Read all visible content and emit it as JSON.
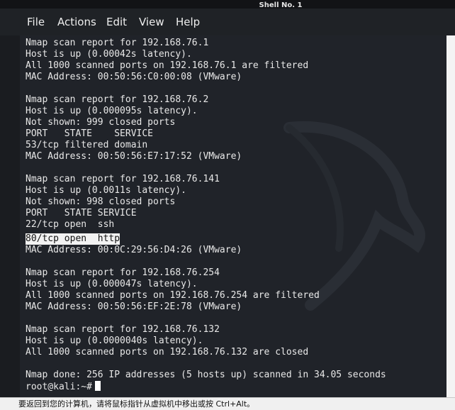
{
  "window": {
    "title": "Shell No. 1"
  },
  "menu": {
    "items": [
      "File",
      "Actions",
      "Edit",
      "View",
      "Help"
    ]
  },
  "terminal": {
    "lines": [
      "Nmap scan report for 192.168.76.1",
      "Host is up (0.00042s latency).",
      "All 1000 scanned ports on 192.168.76.1 are filtered",
      "MAC Address: 00:50:56:C0:00:08 (VMware)",
      "",
      "Nmap scan report for 192.168.76.2",
      "Host is up (0.000095s latency).",
      "Not shown: 999 closed ports",
      "PORT   STATE    SERVICE",
      "53/tcp filtered domain",
      "MAC Address: 00:50:56:E7:17:52 (VMware)",
      "",
      "Nmap scan report for 192.168.76.141",
      "Host is up (0.0011s latency).",
      "Not shown: 998 closed ports",
      "PORT   STATE SERVICE",
      "22/tcp open  ssh",
      "80/tcp open  http",
      "MAC Address: 00:0C:29:56:D4:26 (VMware)",
      "",
      "Nmap scan report for 192.168.76.254",
      "Host is up (0.000047s latency).",
      "All 1000 scanned ports on 192.168.76.254 are filtered",
      "MAC Address: 00:50:56:EF:2E:78 (VMware)",
      "",
      "Nmap scan report for 192.168.76.132",
      "Host is up (0.0000040s latency).",
      "All 1000 scanned ports on 192.168.76.132 are closed",
      "",
      "Nmap done: 256 IP addresses (5 hosts up) scanned in 34.05 seconds",
      "root@kali:~#"
    ],
    "selected_line": "80/tcp open  http"
  },
  "statusbar": {
    "message": "要返回到您的计算机，请将鼠标指针从虚拟机中移出或按 Ctrl+Alt。"
  },
  "colors": {
    "terminal_bg": "#202329",
    "terminal_fg": "#e8e8e8",
    "menubar_bg": "#1f2226",
    "selection_bg": "#f2f2f2"
  }
}
